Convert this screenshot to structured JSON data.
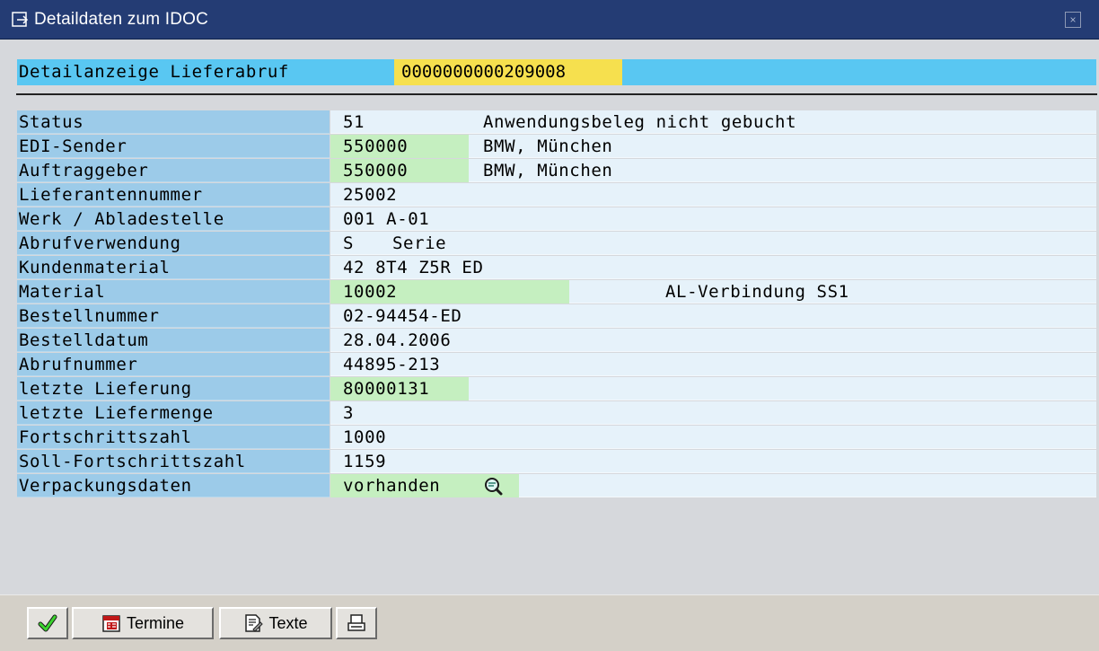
{
  "window": {
    "title": "Detaildaten zum IDOC",
    "close_icon": "close-icon"
  },
  "header": {
    "label": "Detailanzeige Lieferabruf",
    "value": "0000000000209008"
  },
  "rows": [
    {
      "label": "Status",
      "value": "51",
      "desc": "Anwendungsbeleg nicht gebucht"
    },
    {
      "label": "EDI-Sender",
      "value": "550000",
      "desc": "BMW, München"
    },
    {
      "label": "Auftraggeber",
      "value": "550000",
      "desc": "BMW, München"
    },
    {
      "label": "Lieferantennummer",
      "value": "25002"
    },
    {
      "label": "Werk / Abladestelle",
      "value": "001 A-01"
    },
    {
      "label": "Abrufverwendung",
      "value": "S",
      "desc": "Serie"
    },
    {
      "label": "Kundenmaterial",
      "value": "42 8T4 Z5R ED"
    },
    {
      "label": "Material",
      "value": "10002",
      "desc": "AL-Verbindung SS1"
    },
    {
      "label": "Bestellnummer",
      "value": "02-94454-ED"
    },
    {
      "label": "Bestelldatum",
      "value": "28.04.2006"
    },
    {
      "label": "Abrufnummer",
      "value": "44895-213"
    },
    {
      "label": "letzte Lieferung",
      "value": "80000131"
    },
    {
      "label": "letzte Liefermenge",
      "value": "3"
    },
    {
      "label": "Fortschrittszahl",
      "value": "1000"
    },
    {
      "label": "Soll-Fortschrittszahl",
      "value": "1159"
    },
    {
      "label": "Verpackungsdaten",
      "value": "vorhanden",
      "icon": "magnifier-icon"
    }
  ],
  "toolbar": {
    "confirm_icon": "checkmark-icon",
    "termine_label": "Termine",
    "termine_icon": "calendar-icon",
    "texte_label": "Texte",
    "texte_icon": "document-edit-icon",
    "print_icon": "printer-icon"
  },
  "colors": {
    "titlebar": "#243c74",
    "header_row": "#59c7f2",
    "header_value": "#f6e04e",
    "label_bg": "#9ccbe9",
    "value_bg": "#e6f2fa",
    "green_field": "#c5efc0"
  }
}
